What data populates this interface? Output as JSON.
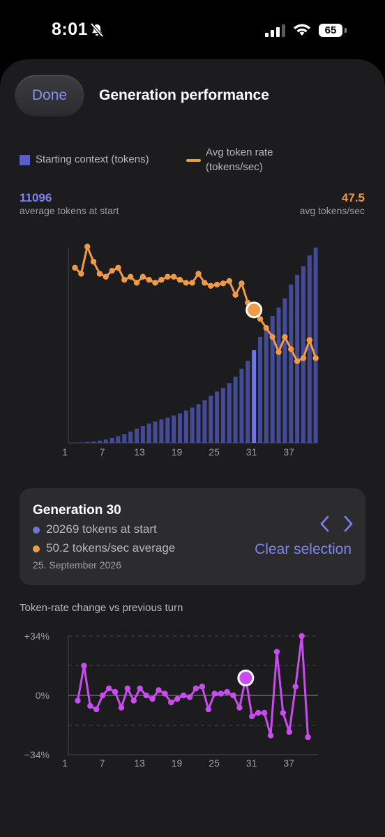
{
  "status_bar": {
    "time": "8:01",
    "battery": "65"
  },
  "header": {
    "done_label": "Done",
    "title": "Generation performance"
  },
  "legend": {
    "context_label": "Starting context (tokens)",
    "rate_label": "Avg token rate (tokens/sec)"
  },
  "stats": {
    "avg_tokens_value": "11096",
    "avg_tokens_caption": "average tokens at start",
    "avg_rate_value": "47.5",
    "avg_rate_caption": "avg tokens/sec"
  },
  "colors": {
    "accent": "#7d82f1",
    "bars": "#444a94",
    "bar_selected": "#6f76e8",
    "rate": "#f09a47",
    "change": "#c84cf0"
  },
  "selection": {
    "title": "Generation 30",
    "tokens_line": "20269 tokens at start",
    "rate_line": "50.2 tokens/sec average",
    "date": "25. September 2026",
    "clear_label": "Clear selection",
    "prev_icon": "chevron-left-icon",
    "next_icon": "chevron-right-icon"
  },
  "section2": {
    "title": "Token-rate change vs previous turn"
  },
  "chart_data": [
    {
      "type": "bar+line",
      "x": [
        1,
        2,
        3,
        4,
        5,
        6,
        7,
        8,
        9,
        10,
        11,
        12,
        13,
        14,
        15,
        16,
        17,
        18,
        19,
        20,
        21,
        22,
        23,
        24,
        25,
        26,
        27,
        28,
        29,
        30,
        31,
        32,
        33,
        34,
        35,
        36,
        37,
        38,
        39,
        40
      ],
      "x_ticks": [
        "1",
        "7",
        "13",
        "19",
        "25",
        "31",
        "37"
      ],
      "series": [
        {
          "name": "Starting context (tokens)",
          "type": "bar",
          "values": [
            0,
            60,
            120,
            200,
            320,
            480,
            700,
            950,
            1250,
            1600,
            2000,
            2350,
            2700,
            3000,
            3300,
            3550,
            3850,
            4150,
            4550,
            4950,
            5450,
            6000,
            6600,
            7200,
            7700,
            8400,
            9300,
            10400,
            11500,
            13000,
            14900,
            16400,
            17800,
            19000,
            20269,
            22200,
            23600,
            24800,
            26300,
            27400
          ]
        },
        {
          "name": "Avg token rate (tokens/sec)",
          "type": "line",
          "values": [
            56.0,
            55.0,
            59.5,
            57.0,
            55.0,
            54.5,
            55.5,
            56.0,
            54.0,
            54.5,
            53.5,
            54.5,
            54.0,
            53.5,
            54.0,
            54.5,
            54.5,
            54.0,
            53.5,
            53.5,
            55.0,
            53.5,
            53.0,
            53.2,
            53.4,
            53.8,
            51.5,
            53.4,
            50.2,
            49.0,
            47.5,
            46.0,
            44.5,
            42.0,
            44.5,
            42.5,
            40.5,
            41.0,
            44.0,
            41.0
          ]
        }
      ],
      "selected_index": 30
    },
    {
      "type": "line",
      "title": "Token-rate change vs previous turn",
      "x": [
        1,
        2,
        3,
        4,
        5,
        6,
        7,
        8,
        9,
        10,
        11,
        12,
        13,
        14,
        15,
        16,
        17,
        18,
        19,
        20,
        21,
        22,
        23,
        24,
        25,
        26,
        27,
        28,
        29,
        30,
        31,
        32,
        33,
        34,
        35,
        36,
        37,
        38,
        39,
        40
      ],
      "x_ticks": [
        "1",
        "7",
        "13",
        "19",
        "25",
        "31",
        "37"
      ],
      "y_ticks": [
        "+34%",
        "0%",
        "−34%"
      ],
      "ylim": [
        -34,
        34
      ],
      "values": [
        -3,
        17,
        -6,
        -8,
        0,
        4,
        2,
        -7,
        4,
        -3,
        4,
        0,
        -2,
        3,
        1,
        -4,
        -2,
        0,
        -1,
        4,
        5,
        -8,
        1,
        1,
        2,
        0,
        -7,
        10,
        -12,
        -10,
        -10,
        -23,
        25,
        -10,
        -21,
        5,
        34,
        -24
      ],
      "selected_index": 30
    }
  ]
}
